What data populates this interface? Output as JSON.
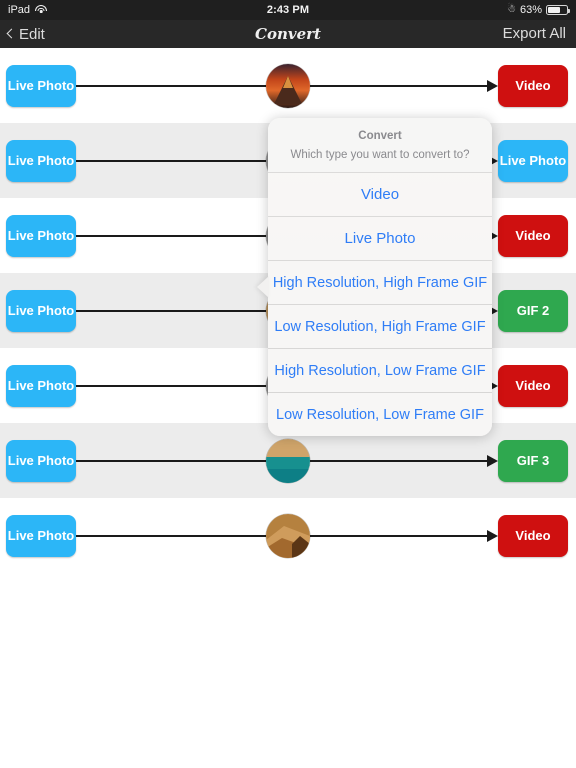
{
  "status_bar": {
    "device": "iPad",
    "wifi_icon": "wifi-icon",
    "time": "2:43 PM",
    "bluetooth_icon": "bluetooth-icon",
    "battery_percent": "63%",
    "battery_icon": "battery-icon"
  },
  "nav_bar": {
    "back_icon": "chevron-left-icon",
    "back_label": "Edit",
    "title": "Convert",
    "right_action": "Export All"
  },
  "colors": {
    "blue_chip": "#2CB6F7",
    "red_chip": "#CF1010",
    "green_chip": "#2FA84F",
    "link_blue": "#2F7DF6",
    "status_bar": "#1F1F1F",
    "nav_bar": "#282828",
    "alt_row": "#ECECEC"
  },
  "rows": [
    {
      "source_label": "Live Photo",
      "target_label": "Video",
      "target_color": "red",
      "thumb": "volcano-sunset-thumbnail",
      "shaded": false
    },
    {
      "source_label": "Live Photo",
      "target_label": "Live Photo",
      "target_color": "blue",
      "thumb": "hidden-thumbnail",
      "shaded": true
    },
    {
      "source_label": "Live Photo",
      "target_label": "Video",
      "target_color": "red",
      "thumb": "hidden-thumbnail",
      "shaded": false
    },
    {
      "source_label": "Live Photo",
      "target_label": "GIF 2",
      "target_color": "green",
      "thumb": "hidden-thumbnail",
      "shaded": true
    },
    {
      "source_label": "Live Photo",
      "target_label": "Video",
      "target_color": "red",
      "thumb": "hidden-thumbnail",
      "shaded": false
    },
    {
      "source_label": "Live Photo",
      "target_label": "GIF 3",
      "target_color": "green",
      "thumb": "beach-ocean-thumbnail",
      "shaded": true
    },
    {
      "source_label": "Live Photo",
      "target_label": "Video",
      "target_color": "red",
      "thumb": "sand-dunes-thumbnail",
      "shaded": false
    }
  ],
  "popover": {
    "title": "Convert",
    "message": "Which type you want to convert to?",
    "options": [
      "Video",
      "Live Photo",
      "High Resolution, High Frame GIF",
      "Low Resolution, High Frame GIF",
      "High Resolution, Low Frame GIF",
      "Low Resolution, Low Frame GIF"
    ]
  }
}
